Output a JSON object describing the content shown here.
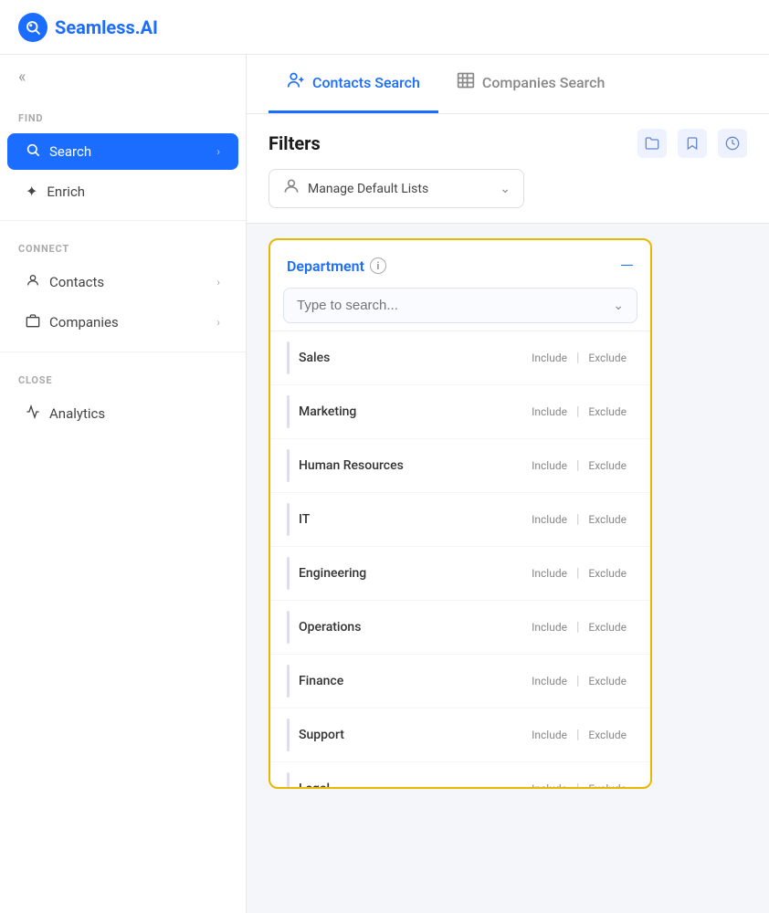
{
  "logo": {
    "icon_symbol": "🔍",
    "text_part1": "Seamless",
    "text_part2": ".AI"
  },
  "sidebar": {
    "collapse_icon": "«",
    "find_label": "FIND",
    "search_label": "Search",
    "enrich_label": "Enrich",
    "connect_label": "CONNECT",
    "contacts_label": "Contacts",
    "companies_label": "Companies",
    "close_label": "CLOSE",
    "analytics_label": "Analytics"
  },
  "tabs": [
    {
      "id": "contacts",
      "label": "Contacts Search",
      "icon": "👥",
      "active": true
    },
    {
      "id": "companies",
      "label": "Companies Search",
      "icon": "🏢",
      "active": false
    }
  ],
  "filters": {
    "title": "Filters",
    "icons": [
      "🗂️",
      "🔖",
      "🕐"
    ],
    "manage_default_label": "Manage Default Lists",
    "manage_default_icon": "👤"
  },
  "department": {
    "title": "Department",
    "info_icon": "i",
    "collapse_icon": "—",
    "search_placeholder": "Type to search...",
    "items": [
      {
        "name": "Sales",
        "include": "Include",
        "exclude": "Exclude"
      },
      {
        "name": "Marketing",
        "include": "Include",
        "exclude": "Exclude"
      },
      {
        "name": "Human Resources",
        "include": "Include",
        "exclude": "Exclude"
      },
      {
        "name": "IT",
        "include": "Include",
        "exclude": "Exclude"
      },
      {
        "name": "Engineering",
        "include": "Include",
        "exclude": "Exclude"
      },
      {
        "name": "Operations",
        "include": "Include",
        "exclude": "Exclude"
      },
      {
        "name": "Finance",
        "include": "Include",
        "exclude": "Exclude"
      },
      {
        "name": "Support",
        "include": "Include",
        "exclude": "Exclude"
      },
      {
        "name": "Legal",
        "include": "Include",
        "exclude": "Exclude"
      }
    ]
  }
}
